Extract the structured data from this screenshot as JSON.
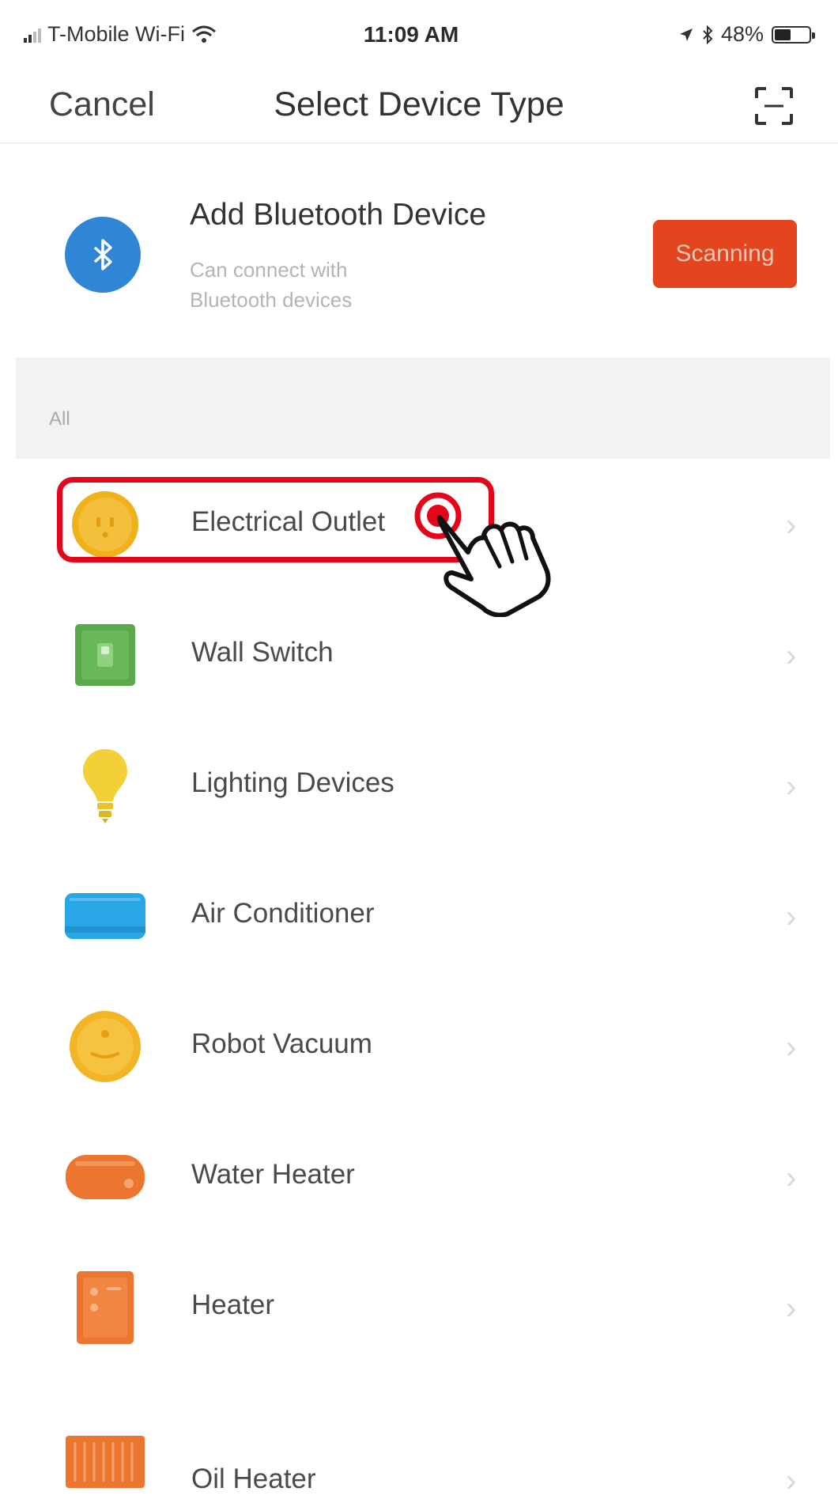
{
  "status_bar": {
    "carrier": "T-Mobile Wi-Fi",
    "time": "11:09 AM",
    "battery": "48%",
    "battery_level": 0.48
  },
  "nav": {
    "cancel_label": "Cancel",
    "title": "Select Device Type",
    "scan_icon": "scan-qr-icon"
  },
  "bluetooth": {
    "title": "Add Bluetooth Device",
    "subtitle_line1": "Can connect with",
    "subtitle_line2": "Bluetooth devices",
    "button_label": "Scanning",
    "icon": "bluetooth-icon",
    "icon_color": "#2f86d6",
    "button_color": "#e4451f"
  },
  "section": {
    "label": "All"
  },
  "devices": [
    {
      "label": "Electrical Outlet",
      "icon": "outlet-icon",
      "color": "#f0b21a"
    },
    {
      "label": "Wall Switch",
      "icon": "wall-switch-icon",
      "color": "#5aaa4c"
    },
    {
      "label": "Lighting Devices",
      "icon": "light-bulb-icon",
      "color": "#f4d038"
    },
    {
      "label": "Air Conditioner",
      "icon": "air-conditioner-icon",
      "color": "#29a6e6"
    },
    {
      "label": "Robot Vacuum",
      "icon": "robot-vacuum-icon",
      "color": "#f3b426"
    },
    {
      "label": "Water Heater",
      "icon": "water-heater-icon",
      "color": "#ec7530"
    },
    {
      "label": "Heater",
      "icon": "heater-icon",
      "color": "#ec7530"
    },
    {
      "label": "Oil Heater",
      "icon": "oil-heater-icon",
      "color": "#ec7530"
    }
  ],
  "overlay": {
    "highlight_color": "#e4051b",
    "hand_icon": "tap-hand-icon"
  }
}
